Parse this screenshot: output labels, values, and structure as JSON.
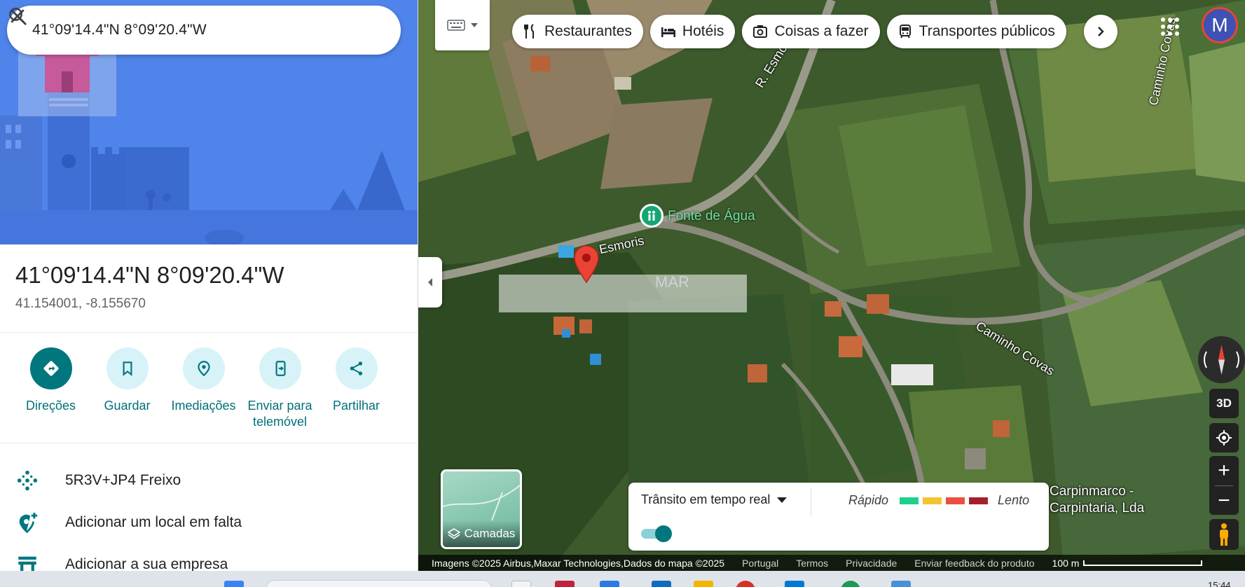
{
  "search": {
    "query": "41°09'14.4\"N 8°09'20.4\"W"
  },
  "place": {
    "title": "41°09'14.4\"N 8°09'20.4\"W",
    "coordinates": "41.154001, -8.155670"
  },
  "actions": [
    {
      "label": "Direções",
      "icon": "directions-icon"
    },
    {
      "label": "Guardar",
      "icon": "bookmark-icon"
    },
    {
      "label": "Imediações",
      "icon": "nearby-icon"
    },
    {
      "label": "Enviar para telemóvel",
      "icon": "send-to-phone-icon"
    },
    {
      "label": "Partilhar",
      "icon": "share-icon"
    }
  ],
  "info_rows": [
    {
      "text": "5R3V+JP4 Freixo",
      "icon": "plus-code-icon"
    },
    {
      "text": "Adicionar um local em falta",
      "icon": "add-place-icon"
    },
    {
      "text": "Adicionar a sua empresa",
      "icon": "store-icon"
    }
  ],
  "map": {
    "category_chips": [
      {
        "label": "Restaurantes",
        "icon": "restaurant-icon"
      },
      {
        "label": "Hotéis",
        "icon": "hotel-icon"
      },
      {
        "label": "Coisas a fazer",
        "icon": "camera-icon"
      },
      {
        "label": "Transportes públicos",
        "icon": "transit-icon"
      }
    ],
    "avatar_letter": "M",
    "labels": {
      "poi": "Fonte de Água",
      "road1": "R. Esmoris",
      "road2": "R. Esmoris",
      "road3": "Caminho Covas",
      "road4": "Caminho Covas",
      "business": "Carpinmarco -\nCarpintaria, Lda",
      "watermark": "MAR"
    },
    "layers_label": "Camadas",
    "traffic": {
      "select_label": "Trânsito em tempo real",
      "fast_label": "Rápido",
      "slow_label": "Lento",
      "colors": [
        "#1ecf8e",
        "#f4c430",
        "#e8513f",
        "#a3202a"
      ]
    },
    "button_3d": "3D",
    "attribution": {
      "imagery": "Imagens ©2025 Airbus,Maxar Technologies,Dados do mapa ©2025",
      "country": "Portugal",
      "terms": "Termos",
      "privacy": "Privacidade",
      "feedback": "Enviar feedback do produto",
      "scale": "100 m"
    }
  },
  "taskbar": {
    "clock": "15:44"
  },
  "colors": {
    "accent": "#00777e",
    "accent_light": "#d8f3f8",
    "hero_blue": "#4b7fe6",
    "pin_red": "#ea4335"
  }
}
